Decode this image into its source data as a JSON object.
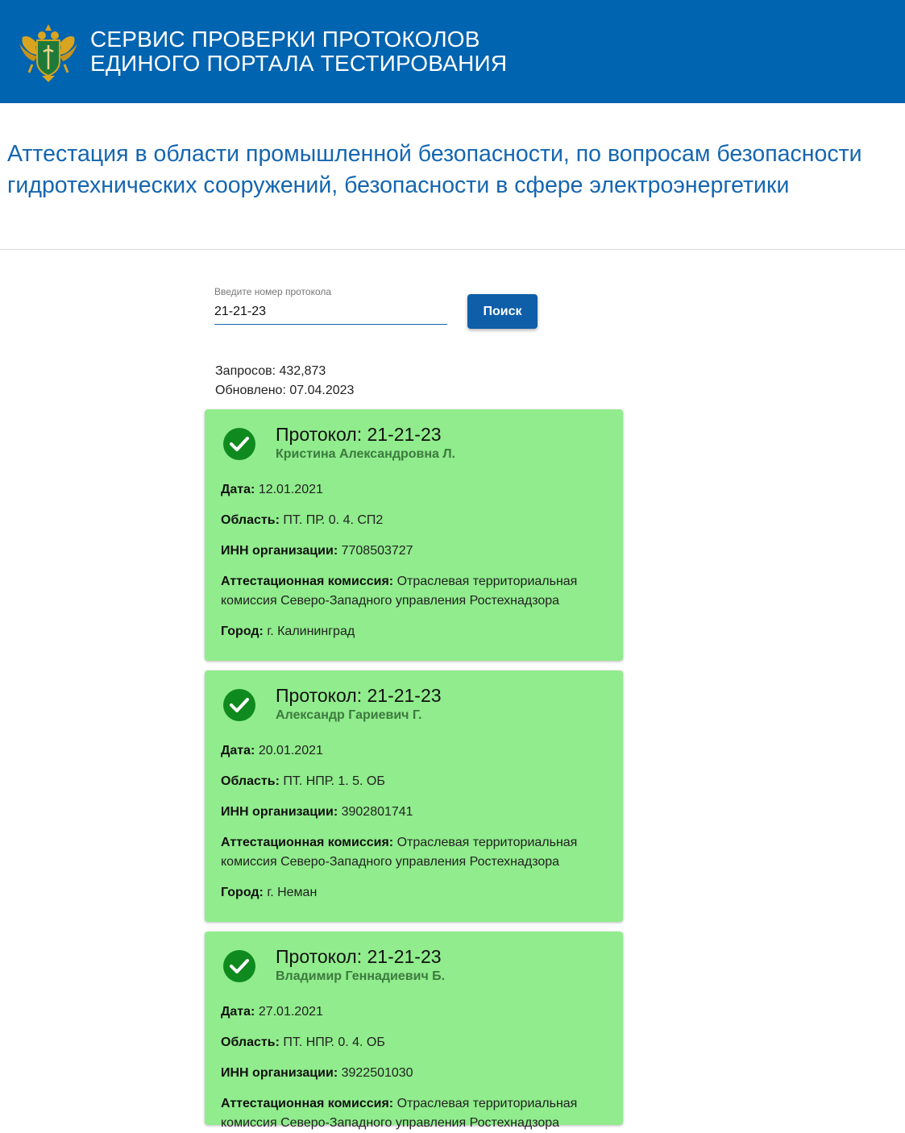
{
  "header": {
    "title_line1": "СЕРВИС ПРОВЕРКИ ПРОТОКОЛОВ",
    "title_line2": "ЕДИНОГО ПОРТАЛА ТЕСТИРОВАНИЯ",
    "logo_icon": "double-headed-eagle-emblem-icon"
  },
  "page_title": "Аттестация в области промышленной безопасности, по вопросам безопасности гидротехнических сооружений, безопасности в сфере электроэнергетики",
  "search": {
    "label": "Введите номер протокола",
    "value": "21-21-23",
    "button_label": "Поиск"
  },
  "stats": {
    "requests": "Запросов: 432,873",
    "updated": "Обновлено: 07.04.2023"
  },
  "colors": {
    "header_bg": "#0064b0",
    "card_bg": "#90ec8c",
    "check": "#0f8a1e",
    "accent": "#1566b0"
  },
  "labels": {
    "date": "Дата:",
    "area": "Область:",
    "inn": "ИНН организации:",
    "commission": "Аттестационная комиссия:",
    "city": "Город:"
  },
  "results": [
    {
      "protocol": "Протокол: 21-21-23",
      "person": "Кристина Александровна Л.",
      "date": "12.01.2021",
      "area": "ПТ. ПР. 0. 4. СП2",
      "inn": "7708503727",
      "commission": "Отраслевая территориальная комиссия Северо-Западного управления Ростехнадзора",
      "city": "г. Калининград"
    },
    {
      "protocol": "Протокол: 21-21-23",
      "person": "Александр Гариевич Г.",
      "date": "20.01.2021",
      "area": "ПТ. НПР. 1. 5. ОБ",
      "inn": "3902801741",
      "commission": "Отраслевая территориальная комиссия Северо-Западного управления Ростехнадзора",
      "city": "г. Неман"
    },
    {
      "protocol": "Протокол: 21-21-23",
      "person": "Владимир Геннадиевич Б.",
      "date": "27.01.2021",
      "area": "ПТ. НПР. 0. 4. ОБ",
      "inn": "3922501030",
      "commission": "Отраслевая территориальная комиссия Северо-Западного управления Ростехнадзора",
      "city": ""
    }
  ]
}
